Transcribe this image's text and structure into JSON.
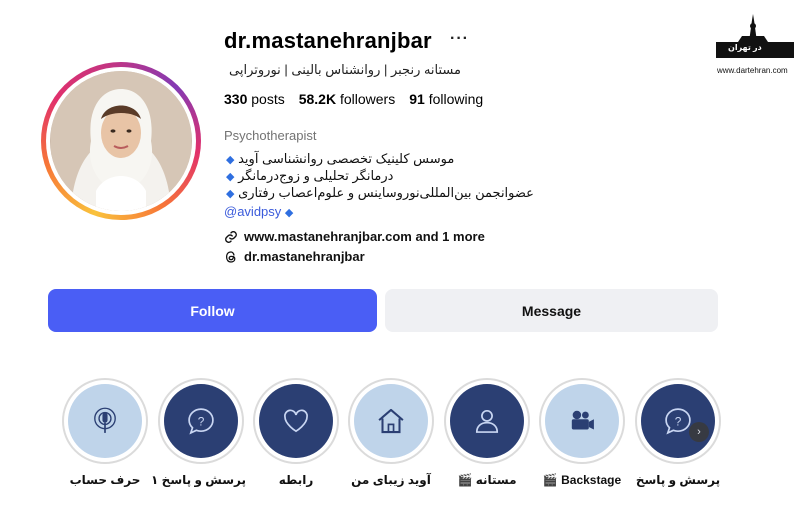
{
  "profile": {
    "username": "dr.mastanehranjbar",
    "more": "···",
    "subtitle": "مستانه رنجبر | روانشناس بالینی | نوروتراپی",
    "stats": {
      "posts_count": "330",
      "posts_label": "posts",
      "followers_count": "58.2K",
      "followers_label": "followers",
      "following_count": "91",
      "following_label": "following"
    },
    "category": "Psychotherapist",
    "bio": [
      "موسس کلینیک تخصصی روانشناسی آوید",
      "درمانگر تحلیلی و زوج‌درمانگر",
      "عضوانجمن بین‌المللی‌نوروساینس و علوم‌اعصاب رفتاری"
    ],
    "bio_tag": "@avidpsy",
    "website": "www.mastanehranjbar.com and 1 more",
    "threads": "dr.mastanehranjbar"
  },
  "actions": {
    "follow": "Follow",
    "message": "Message"
  },
  "highlights": [
    {
      "label": "پرسش و پاسخ",
      "icon": "question-icon",
      "style": "dark"
    },
    {
      "label": "Backstage 🎬",
      "icon": "camera-icon",
      "style": "light"
    },
    {
      "label": "مستانه 🎬",
      "icon": "person-icon",
      "style": "dark"
    },
    {
      "label": "آوید زیبای من",
      "icon": "home-icon",
      "style": "light"
    },
    {
      "label": "رابطه",
      "icon": "heart-icon",
      "style": "dark"
    },
    {
      "label": "پرسش و پاسخ ۱",
      "icon": "question-icon",
      "style": "dark"
    },
    {
      "label": "حرف حساب",
      "icon": "podcast-icon",
      "style": "light"
    }
  ],
  "watermark": {
    "text": "در تهران",
    "url": "www.dartehran.com"
  },
  "colors": {
    "follow_button": "#4a5ef5",
    "message_button": "#eff0f3",
    "highlight_dark": "#2b3f73",
    "highlight_light": "#bfd4ea",
    "bio_diamond": "#2f6fe0"
  }
}
